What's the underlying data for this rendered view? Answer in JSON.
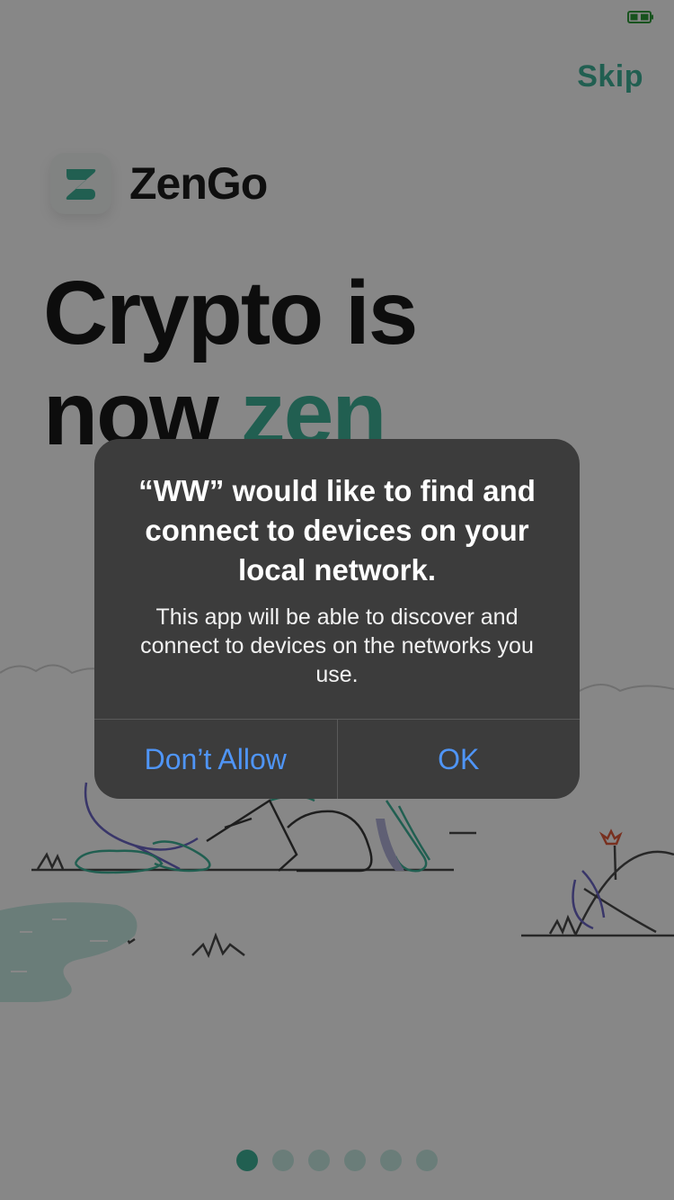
{
  "app": {
    "skip_label": "Skip",
    "brand_name": "ZenGo",
    "headline_line1": "Crypto is",
    "headline_line2_a": "now ",
    "headline_line2_accent": "zen",
    "pagination": {
      "pages": 6,
      "current": 1
    }
  },
  "alert": {
    "title": "“WW” would like to find and connect to devices on your local network.",
    "message": "This app will be able to discover and connect to devices on the networks you use.",
    "deny_label": "Don’t Allow",
    "ok_label": "OK"
  },
  "colors": {
    "accent": "#3fb39a",
    "alert_background": "#3c3c3c",
    "alert_button_text": "#4f95f7",
    "status_battery": "#2e9e3a"
  },
  "icons": [
    "battery-icon",
    "zengo-logo-icon"
  ]
}
